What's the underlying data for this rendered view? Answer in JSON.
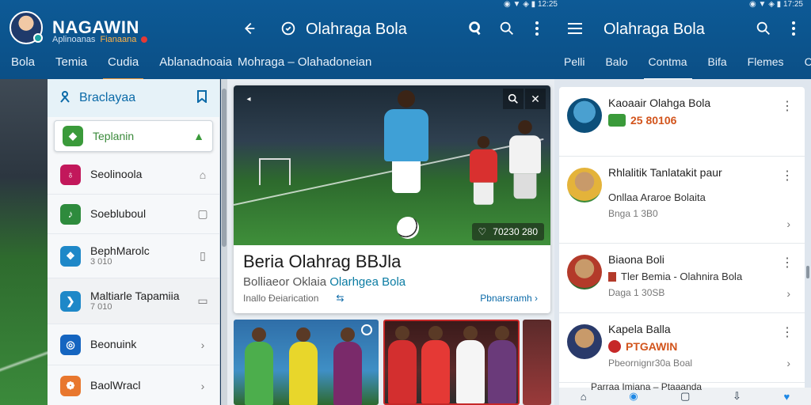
{
  "status": {
    "left": "◉ ▼ ◈ ▮ 12:25",
    "right": "◉ ▼ ◈ ▮ 17:25"
  },
  "app": {
    "brand": "NAGAWIN",
    "brand_sub": "Aplinoanas",
    "brand_sub2": "Fianaana"
  },
  "left_nav": [
    {
      "label": "Bola"
    },
    {
      "label": "Temia"
    },
    {
      "label": "Cudia",
      "active": true
    },
    {
      "label": "Ablanadnoaia"
    }
  ],
  "mid_header": {
    "title": "Olahraga Bola",
    "crumb": "Mohraga  –  Olahadoneian"
  },
  "right_header": {
    "title": "Olahraga Bola"
  },
  "right_nav": [
    {
      "label": "Pelli"
    },
    {
      "label": "Balo"
    },
    {
      "label": "Contma",
      "active": true
    },
    {
      "label": "Bifa"
    },
    {
      "label": "Flemes"
    },
    {
      "label": "Cno"
    }
  ],
  "sidebar": {
    "header": "Braclayaa",
    "items": [
      {
        "label": "Teplanin",
        "color": "#3a9a3a",
        "glyph": "◆",
        "trail": "▲",
        "selected": true
      },
      {
        "label": "Seolinoola",
        "color": "#c2185b",
        "glyph": "♁",
        "trail": "⌂"
      },
      {
        "label": "Soebluboul",
        "color": "#2e8b3d",
        "glyph": "♪",
        "trail": "▢"
      },
      {
        "label": "BephMarolc",
        "sub": "3 010",
        "color": "#1e88c8",
        "glyph": "❖",
        "trail": "▯"
      },
      {
        "label": "Maltiarle Tapamiia",
        "sub": "7 010",
        "color": "#1e88c8",
        "glyph": "❯",
        "trail": "▭"
      },
      {
        "label": "Beonuink",
        "color": "#1565c0",
        "glyph": "◎",
        "trail": "›"
      },
      {
        "label": "BaolWracl",
        "color": "#e8772e",
        "glyph": "❁",
        "trail": "›"
      }
    ]
  },
  "hero": {
    "badge": "70230 280",
    "title": "Beria  Olahrag BBJla",
    "subtitle_a": "Bolliaeor Oklaia",
    "subtitle_b": "Olarhgea Bola",
    "meta": "Inallo Ðeiarication",
    "link": "Pbnarsramh"
  },
  "right_list": [
    {
      "title": "Kaoaair Olahga Bola",
      "line": "25 80106",
      "line_accent": true,
      "avatar": "#0c4f7a"
    },
    {
      "title": "Rhlalitik Tanlatakit paur",
      "line": "Onllaa Araroe Bolaita",
      "sub": "Bnga 1 3B0",
      "avatar": "#e4b33a"
    },
    {
      "title": "Biaona Boli",
      "line": "Tler Bemia - Olahnira Bola",
      "sub": "Daga 1 30SB",
      "avatar": "#b33a2a"
    },
    {
      "title": "Kapela Balla",
      "line": "PTGAWIN",
      "line_accent": true,
      "sub": "Pbeornignr30a Boal",
      "avatar": "#2a3a6a"
    }
  ],
  "right_footer": "Parraa Imiana – Ptaaanda",
  "icons": {
    "back": "back-icon",
    "clock": "clock-icon",
    "menu": "menu-icon",
    "search": "search-icon",
    "more": "more-vert-icon"
  }
}
